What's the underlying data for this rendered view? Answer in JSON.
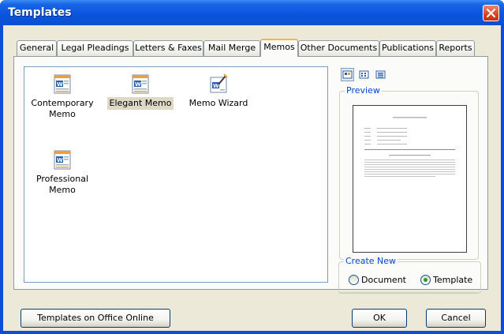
{
  "window": {
    "title": "Templates"
  },
  "tabs": [
    {
      "label": "General"
    },
    {
      "label": "Legal Pleadings"
    },
    {
      "label": "Letters & Faxes"
    },
    {
      "label": "Mail Merge"
    },
    {
      "label": "Memos",
      "active": true
    },
    {
      "label": "Other Documents"
    },
    {
      "label": "Publications"
    },
    {
      "label": "Reports"
    }
  ],
  "files": [
    {
      "label": "Contemporary Memo",
      "icon": "word-document-template-icon"
    },
    {
      "label": "Elegant Memo",
      "icon": "word-document-template-icon",
      "selected": true
    },
    {
      "label": "Memo Wizard",
      "icon": "word-wizard-icon"
    },
    {
      "label": "Professional Memo",
      "icon": "word-document-template-icon"
    }
  ],
  "views": [
    {
      "name": "large-icons-view",
      "selected": true
    },
    {
      "name": "list-view"
    },
    {
      "name": "details-view"
    }
  ],
  "preview": {
    "label": "Preview"
  },
  "create_new": {
    "label": "Create New",
    "options": [
      {
        "label": "Document",
        "checked": false
      },
      {
        "label": "Template",
        "checked": true
      }
    ]
  },
  "buttons": {
    "office_online": "Templates on Office Online",
    "ok": "OK",
    "cancel": "Cancel"
  },
  "colors": {
    "titlebar": "#0a55dc",
    "dialog_bg": "#ece9d8",
    "active_tab_accent": "#f9b63b",
    "selection": "#ddd9c5",
    "group_label": "#0046d5",
    "radio_dot": "#21a121"
  }
}
